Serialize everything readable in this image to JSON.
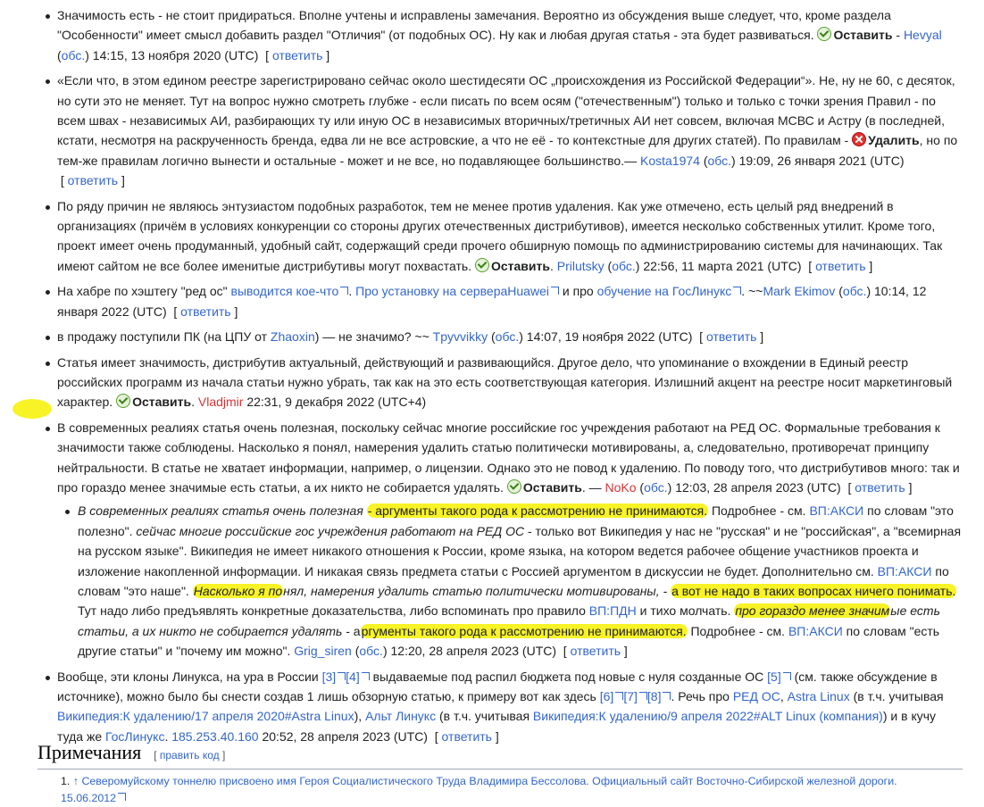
{
  "comments": [
    {
      "text1": "Значимость есть - не стоит придираться. Вполне учтены и исправлены замечания. Вероятно из обсуждения выше следует, что, кроме раздела \"Особенности\" имеет смысл добавить раздел \"Отличия\" (от подобных ОС). Ну как и любая другая статья - эта будет развиваться.",
      "vote": "Оставить",
      "dash": " - ",
      "user": "Hevyal",
      "talk": "обс.",
      "timestamp": "14:15, 13 ноября 2020 (UTC)",
      "reply": "ответить"
    },
    {
      "text1": "«Если что, в этом едином реестре зарегистрировано сейчас около шестидесяти ОС „происхождения из Российской Федерации“». Не, ну не 60, с десяток, но сути это не меняет. Тут на вопрос нужно смотреть глубже - если писать по всем осям (\"отечественным\") только и только с точки зрения Правил - по всем швах - независимых АИ, разбирающих ту или иную ОС в независимых вторичных/третичных АИ нет совсем, включая МСВС и Астру (в последней, кстати, несмотря на раскрученность бренда, едва ли не все астровские, а что не её - то контекстные для других статей). По правилам -",
      "vote": "Удалить",
      "text2": ", но по тем-же правилам логично вынести и остальные - может и не все, но подавляющее большинство.—",
      "user": "Kosta1974",
      "talk": "обс.",
      "timestamp": "19:09, 26 января 2021 (UTC)",
      "reply": "ответить"
    },
    {
      "text1": "По ряду причин не являюсь энтузиастом подобных разработок, тем не менее против удаления. Как уже отмечено, есть целый ряд внедрений в организациях (причём в условиях конкуренции со стороны других отечественных дистрибутивов), имеется несколько собственных утилит. Кроме того, проект имеет очень продуманный, удобный сайт, содержащий среди прочего обширную помощь по администрированию системы для начинающих. Так имеют сайтом не все более именитые дистрибутивы могут похвастать.",
      "vote": "Оставить",
      "user": "Prilutsky",
      "talk": "обс.",
      "timestamp": "22:56, 11 марта 2021 (UTC)",
      "reply": "ответить"
    },
    {
      "text1": "На хабре по хэштегу \"ред ос\"",
      "link1": "выводится кое-что",
      "sep1": ".",
      "link2": "Про установку на сервераHuawei",
      "sep2": " и про ",
      "link3": "обучение на ГосЛинукс",
      "sep3": ". ~~",
      "user": "Mark Ekimov",
      "talk": "обс.",
      "timestamp": "10:14, 12 января 2022 (UTC)",
      "reply": "ответить"
    },
    {
      "text1": "в продажу поступили ПК (на ЦПУ от",
      "link1": "Zhaoxin",
      "text2": ") — не значимо? ~~",
      "user": "Tpyvvikky",
      "talk": "обс.",
      "timestamp": "14:07, 19 ноября 2022 (UTC)",
      "reply": "ответить"
    },
    {
      "text1": "Статья имеет значимость, дистрибутив актуальный, действующий и развивающийся. Другое дело, что упоминание о вхождении в Единый реестр российских программ из начала статьи нужно убрать, так как на это есть соответствующая категория. Излишний акцент на реестре носит маркетинговый характер.",
      "vote": "Оставить",
      "user": "Vladjmir",
      "timestamp": "22:31, 9 декабря 2022 (UTC+4)"
    },
    {
      "text1": "В современных реалиях статья очень полезная, поскольку сейчас многие российские гос учреждения работают на РЕД ОС. Формальные требования к значимости также соблюдены. Насколько я понял, намерения удалить статью политически мотивированы, а, следовательно, противоречат принципу нейтральности. В статье не хватает информации, например, о лицензии. Однако это не повод к удалению. По поводу того, что дистрибутивов много: так и про гораздо менее значимые есть статьи, а их никто не собирается удалять.",
      "vote": "Оставить",
      "dash": ". — ",
      "user": "NoKo",
      "talk": "обс.",
      "timestamp": "12:03, 28 апреля 2023 (UTC)",
      "reply": "ответить"
    }
  ],
  "subreply": {
    "q1": "В современных реалиях статья очень полезная",
    "h1": "- аргументы такого рода к рассмотрению не принимаются.",
    "t1": " Подробнее - см. ",
    "l1": "ВП:АКСИ",
    "t2": " по словам \"это полезно\". ",
    "q2": "сейчас многие российские гос учреждения работают на РЕД ОС",
    "t3": " - только вот Википедия у нас не \"русская\" и не \"российская\", а \"всемирная на русском языке\". Википедия не имеет никакого отношения к России, кроме языка, на котором ведется рабочее общение участников проекта и изложение накопленной информации. И никакая связь предмета статьи с Россией аргументом в дискуссии не будет. Дополнительно см. ",
    "l2": "ВП:АКСИ",
    "t4": " по словам \"это наше\". ",
    "q3a": "Насколько я по",
    "q3b": "нял, намерения удалить статью политически мотивированы, - ",
    "h2": "а вот не надо в таких вопросах ничего понимать.",
    "t5": " Тут надо либо предъявлять конкретные доказательства, либо вспоминать про правило ",
    "l3": "ВП:ПДН",
    "t6": " и тихо молчать. ",
    "q4a": "про гораздо менее значим",
    "q4b": "ые есть статьи, а их никто не собирается удалять",
    "t7": " - а",
    "h3": "ргументы такого рода к рассмотрению не принимаются.",
    "t8": " Подробнее - см. ",
    "l4": "ВП:АКСИ",
    "t9": " по словам \"есть другие статьи\" и \"почему им можно\". ",
    "user": "Grig_siren",
    "talk": "обс.",
    "timestamp": "12:20, 28 апреля 2023 (UTC)",
    "reply": "ответить"
  },
  "last": {
    "t1": "Вообще, эти клоны Линукса, на ура в России ",
    "r3": "[3]",
    "r4": "[4]",
    "t2": " выдаваемые под распил бюджета под новые с нуля созданные ОС ",
    "r5": "[5]",
    "t3": " (см. также обсуждение в источнике), можно было бы снести создав 1 лишь обзорную статью, к примеру вот как здесь ",
    "r6": "[6]",
    "r7": "[7]",
    "r8": "[8]",
    "t4": ". Речь про ",
    "l1": "РЕД ОС",
    "t5": ", ",
    "l2": "Astra Linux",
    "t6": " (в т.ч. учитывая ",
    "l3": "Википедия:К удалению/17 апреля 2020#Astra Linux",
    "t7": "), ",
    "l4": "Альт Линукс",
    "t8": " (в т.ч. учитывая ",
    "l5": "Википедия:К удалению/9 апреля 2022#ALT Linux (компания)",
    "t9": ") и в кучу туда же ",
    "l6": "ГосЛинукс",
    "t10": ". ",
    "ip": "185.253.40.160",
    "timestamp": " 20:52, 28 апреля 2023 (UTC)",
    "reply": "ответить"
  },
  "section": {
    "title": "Примечания",
    "edit": "править код"
  },
  "refs": [
    {
      "num": "1.",
      "arrow": "↑",
      "text": " Северомуйскому тоннелю присвоено имя Героя Социалистического Труда Владимира Бессолова. Официальный сайт Восточно-Сибирской железной дороги.",
      "date": "15.06.2012"
    }
  ]
}
